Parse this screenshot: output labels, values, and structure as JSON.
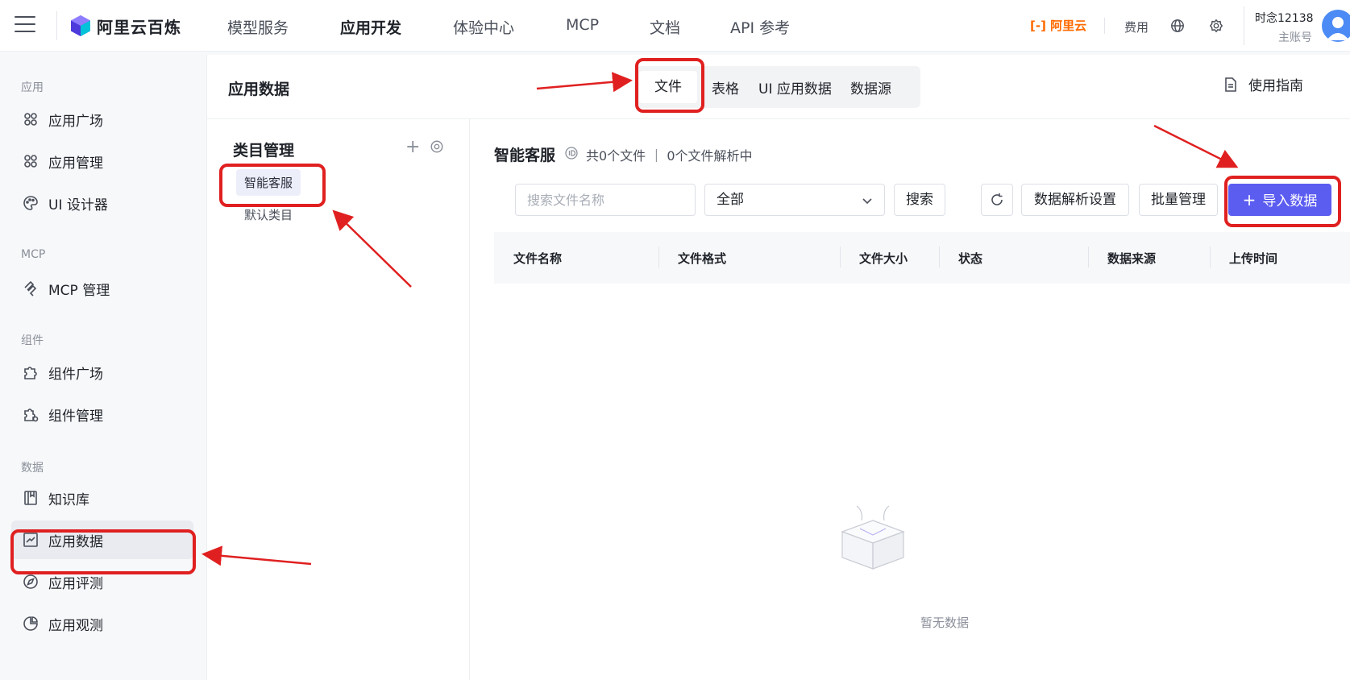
{
  "topbar": {
    "brand": "阿里云百炼",
    "nav": [
      "模型服务",
      "应用开发",
      "体验中心",
      "MCP",
      "文档",
      "API 参考"
    ],
    "aliyun": "[-] 阿里云",
    "billing": "费用",
    "user": "时念12138",
    "role": "主账号"
  },
  "sidebar": {
    "group_app": "应用",
    "app_square": "应用广场",
    "app_manage": "应用管理",
    "ui_designer": "UI 设计器",
    "group_mcp": "MCP",
    "mcp_manage": "MCP 管理",
    "group_component": "组件",
    "component_square": "组件广场",
    "component_manage": "组件管理",
    "group_data": "数据",
    "knowledge": "知识库",
    "app_data": "应用数据",
    "app_eval": "应用评测",
    "app_observe": "应用观测"
  },
  "header": {
    "title": "应用数据",
    "tabs": [
      "文件",
      "表格",
      "UI 应用数据",
      "数据源"
    ],
    "guide": "使用指南"
  },
  "category": {
    "title": "类目管理",
    "add": "+",
    "items": [
      "智能客服",
      "默认类目"
    ]
  },
  "content": {
    "title": "智能客服",
    "count": "共0个文件 ｜ 0个文件解析中",
    "search_placeholder": "搜索文件名称",
    "filter": "全部",
    "search_button": "搜索",
    "parse_settings": "数据解析设置",
    "batch_manage": "批量管理",
    "import": "导入数据",
    "columns": [
      "文件名称",
      "文件格式",
      "文件大小",
      "状态",
      "数据来源",
      "上传时间"
    ],
    "empty": "暂无数据"
  },
  "colors": {
    "primary": "#5b5cf0",
    "annotation": "#e02020",
    "aliyun": "#ff6a00"
  }
}
